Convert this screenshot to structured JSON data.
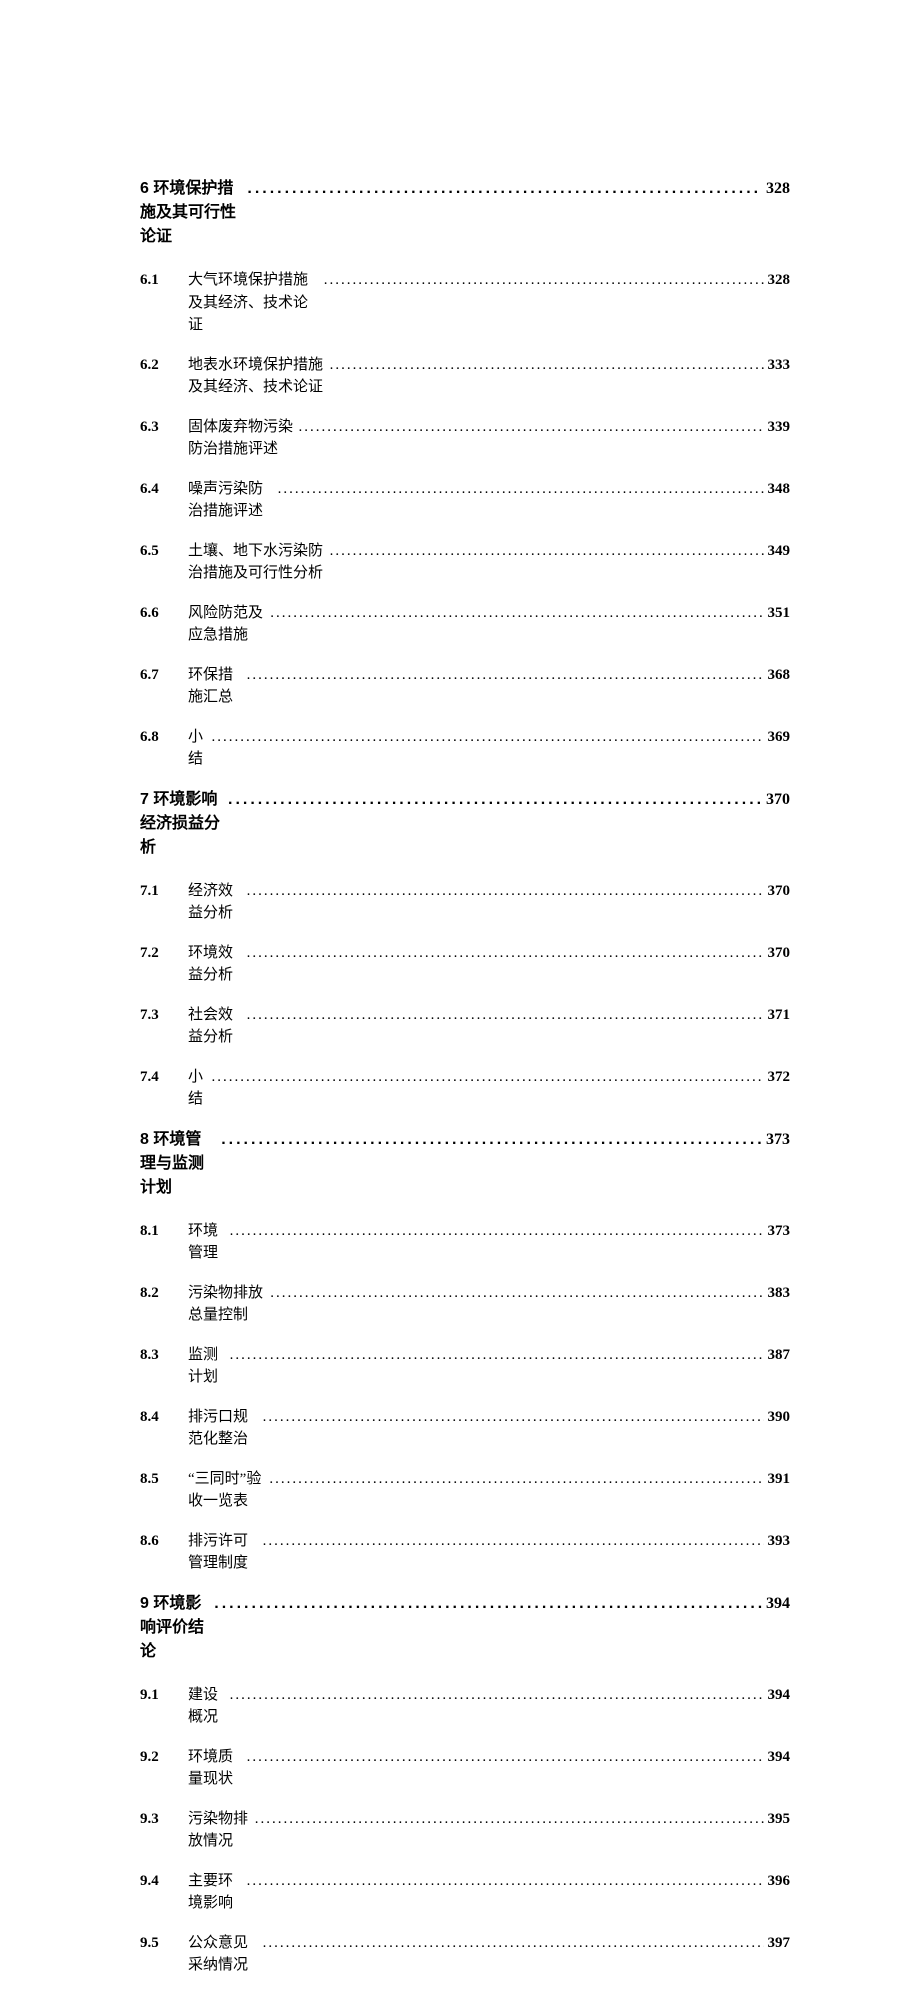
{
  "toc": [
    {
      "level": "chapter",
      "num": "6",
      "title": "环境保护措施及其可行性论证",
      "page": "328"
    },
    {
      "level": "sub",
      "num": "6.1",
      "title": "大气环境保护措施及其经济、技术论证",
      "page": "328"
    },
    {
      "level": "sub",
      "num": "6.2",
      "title": "地表水环境保护措施及其经济、技术论证",
      "page": "333"
    },
    {
      "level": "sub",
      "num": "6.3",
      "title": "固体废弃物污染防治措施评述",
      "page": "339"
    },
    {
      "level": "sub",
      "num": "6.4",
      "title": "噪声污染防治措施评述",
      "page": "348"
    },
    {
      "level": "sub",
      "num": "6.5",
      "title": "土壤、地下水污染防治措施及可行性分析",
      "page": "349"
    },
    {
      "level": "sub",
      "num": "6.6",
      "title": "风险防范及应急措施",
      "page": "351"
    },
    {
      "level": "sub",
      "num": "6.7",
      "title": "环保措施汇总",
      "page": "368"
    },
    {
      "level": "sub",
      "num": "6.8",
      "title": "小结",
      "page": "369"
    },
    {
      "level": "chapter",
      "num": "7",
      "title": "环境影响经济损益分析",
      "page": "370"
    },
    {
      "level": "sub",
      "num": "7.1",
      "title": "经济效益分析",
      "page": "370"
    },
    {
      "level": "sub",
      "num": "7.2",
      "title": "环境效益分析",
      "page": "370"
    },
    {
      "level": "sub",
      "num": "7.3",
      "title": "社会效益分析",
      "page": "371"
    },
    {
      "level": "sub",
      "num": "7.4",
      "title": "小结",
      "page": "372"
    },
    {
      "level": "chapter",
      "num": "8",
      "title": "环境管理与监测计划",
      "page": "373"
    },
    {
      "level": "sub",
      "num": "8.1",
      "title": "环境管理",
      "page": "373"
    },
    {
      "level": "sub",
      "num": "8.2",
      "title": "污染物排放总量控制",
      "page": "383"
    },
    {
      "level": "sub",
      "num": "8.3",
      "title": "监测计划",
      "page": "387"
    },
    {
      "level": "sub",
      "num": "8.4",
      "title": "排污口规范化整治",
      "page": "390"
    },
    {
      "level": "sub",
      "num": "8.5",
      "title": "“三同时”验收一览表",
      "page": "391"
    },
    {
      "level": "sub",
      "num": "8.6",
      "title": "排污许可管理制度",
      "page": "393"
    },
    {
      "level": "chapter",
      "num": "9",
      "title": "环境影响评价结论",
      "page": "394"
    },
    {
      "level": "sub",
      "num": "9.1",
      "title": "建设概况",
      "page": "394"
    },
    {
      "level": "sub",
      "num": "9.2",
      "title": "环境质量现状",
      "page": "394"
    },
    {
      "level": "sub",
      "num": "9.3",
      "title": "污染物排放情况",
      "page": "395"
    },
    {
      "level": "sub",
      "num": "9.4",
      "title": "主要环境影响",
      "page": "396"
    },
    {
      "level": "sub",
      "num": "9.5",
      "title": "公众意见采纳情况",
      "page": "397"
    }
  ]
}
